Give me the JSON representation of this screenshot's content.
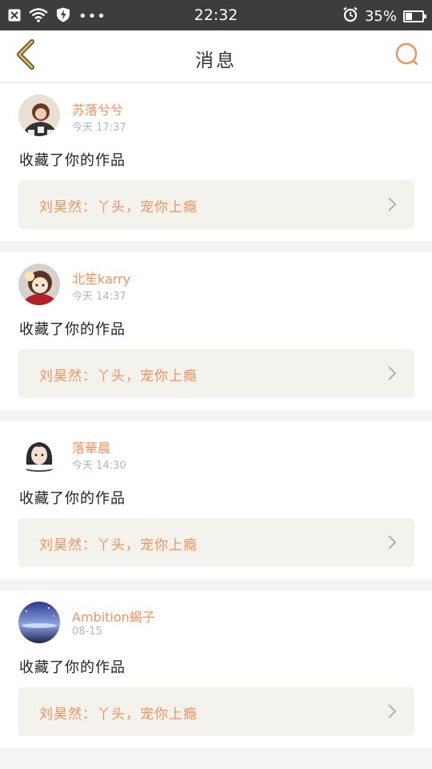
{
  "status_bar": {
    "time": "22:32",
    "battery_percent": "35%",
    "battery_level": 0.35,
    "icons": [
      "close-icon",
      "wifi-icon",
      "shield-bolt-icon",
      "more-dots-icon",
      "alarm-clock-icon",
      "battery-icon"
    ]
  },
  "header": {
    "title": "消息",
    "back_icon": "chevron-left-icon",
    "search_icon": "search-icon",
    "accent": "#f0925e",
    "back_color": "#e8b84b"
  },
  "messages": [
    {
      "user": "苏落兮兮",
      "time": "今天 17:37",
      "action": "收藏了你的作品",
      "quote": "刘昊然：丫头，宠你上瘾"
    },
    {
      "user": "北笙karry",
      "time": "今天 14:37",
      "action": "收藏了你的作品",
      "quote": "刘昊然：丫头，宠你上瘾"
    },
    {
      "user": "落華晨",
      "time": "今天 14:30",
      "action": "收藏了你的作品",
      "quote": "刘昊然：丫头，宠你上瘾"
    },
    {
      "user": "Ambition蝎子",
      "time": "08-15",
      "action": "收藏了你的作品",
      "quote": "刘昊然：丫头，宠你上瘾"
    }
  ],
  "colors": {
    "status_bg": "#3d3d3d",
    "name_color": "#f0925e",
    "quote_bg": "#f3f2ec"
  }
}
